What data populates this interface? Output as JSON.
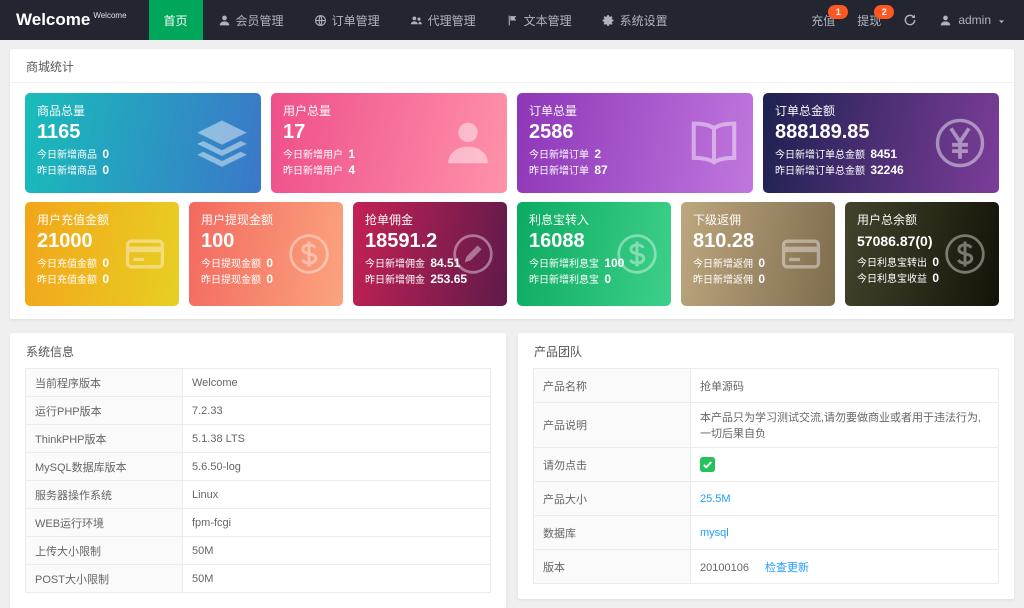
{
  "navbar": {
    "brand": "Welcome",
    "brand_sup": "Welcome",
    "menu": [
      {
        "label": "首页",
        "icon": "",
        "active": true
      },
      {
        "label": "会员管理",
        "icon": "user",
        "active": false
      },
      {
        "label": "订单管理",
        "icon": "globe",
        "active": false
      },
      {
        "label": "代理管理",
        "icon": "users",
        "active": false
      },
      {
        "label": "文本管理",
        "icon": "flag",
        "active": false
      },
      {
        "label": "系统设置",
        "icon": "gear",
        "active": false
      }
    ],
    "actions": [
      {
        "label": "充值",
        "badge": "1"
      },
      {
        "label": "提现",
        "badge": "2"
      }
    ],
    "user": {
      "name": "admin"
    }
  },
  "stats": {
    "title": "商城统计",
    "row1": [
      {
        "title": "商品总量",
        "value": "1165",
        "icon": "layers",
        "grad": [
          "#18bdba",
          "#3b77c9"
        ],
        "lines": [
          {
            "label": "今日新增商品",
            "value": "0"
          },
          {
            "label": "昨日新增商品",
            "value": "0"
          }
        ]
      },
      {
        "title": "用户总量",
        "value": "17",
        "icon": "user",
        "grad": [
          "#ee4f8b",
          "#ff92a9"
        ],
        "lines": [
          {
            "label": "今日新增用户",
            "value": "1"
          },
          {
            "label": "昨日新增用户",
            "value": "4"
          }
        ]
      },
      {
        "title": "订单总量",
        "value": "2586",
        "icon": "book",
        "grad": [
          "#8d36b8",
          "#c077dd"
        ],
        "lines": [
          {
            "label": "今日新增订单",
            "value": "2"
          },
          {
            "label": "昨日新增订单",
            "value": "87"
          }
        ]
      },
      {
        "title": "订单总金额",
        "value": "888189.85",
        "icon": "yen",
        "grad": [
          "#1e2150",
          "#7c3d99"
        ],
        "lines": [
          {
            "label": "今日新增订单总金额",
            "value": "8451"
          },
          {
            "label": "昨日新增订单总金额",
            "value": "32246"
          }
        ]
      }
    ],
    "row2": [
      {
        "title": "用户充值金额",
        "value": "21000",
        "icon": "card",
        "grad": [
          "#f2a51a",
          "#e8cf24"
        ],
        "lines": [
          {
            "label": "今日充值金额",
            "value": "0"
          },
          {
            "label": "昨日充值金额",
            "value": "0"
          }
        ]
      },
      {
        "title": "用户提现金额",
        "value": "100",
        "icon": "dollar",
        "grad": [
          "#f3695f",
          "#fba47e"
        ],
        "lines": [
          {
            "label": "今日提现金额",
            "value": "0"
          },
          {
            "label": "昨日提现金额",
            "value": "0"
          }
        ]
      },
      {
        "title": "抢单佣金",
        "value": "18591.2",
        "icon": "edit",
        "grad": [
          "#c42154",
          "#5f1a4a"
        ],
        "lines": [
          {
            "label": "今日新增佣金",
            "value": "84.51"
          },
          {
            "label": "昨日新增佣金",
            "value": "253.65"
          }
        ]
      },
      {
        "title": "利息宝转入",
        "value": "16088",
        "icon": "dollar",
        "grad": [
          "#0cab61",
          "#3ed08a"
        ],
        "lines": [
          {
            "label": "今日新增利息宝",
            "value": "100"
          },
          {
            "label": "昨日新增利息宝",
            "value": "0"
          }
        ]
      },
      {
        "title": "下级返佣",
        "value": "810.28",
        "icon": "card",
        "grad": [
          "#bda77e",
          "#7e6c4e"
        ],
        "lines": [
          {
            "label": "今日新增返佣",
            "value": "0"
          },
          {
            "label": "昨日新增返佣",
            "value": "0"
          }
        ]
      },
      {
        "title": "用户总余额",
        "value": "57086.87(0)",
        "icon": "dollar",
        "grad": [
          "#43442c",
          "#131308"
        ],
        "lines": [
          {
            "label": "今日利息宝转出",
            "value": "0"
          },
          {
            "label": "今日利息宝收益",
            "value": "0"
          }
        ]
      }
    ]
  },
  "system_info": {
    "title": "系统信息",
    "rows": [
      {
        "label": "当前程序版本",
        "value": "Welcome"
      },
      {
        "label": "运行PHP版本",
        "value": "7.2.33"
      },
      {
        "label": "ThinkPHP版本",
        "value": "5.1.38 LTS"
      },
      {
        "label": "MySQL数据库版本",
        "value": "5.6.50-log"
      },
      {
        "label": "服务器操作系统",
        "value": "Linux"
      },
      {
        "label": "WEB运行环境",
        "value": "fpm-fcgi"
      },
      {
        "label": "上传大小限制",
        "value": "50M"
      },
      {
        "label": "POST大小限制",
        "value": "50M"
      }
    ]
  },
  "product_team": {
    "title": "产品团队",
    "rows": [
      {
        "label": "产品名称",
        "value": "抢单源码",
        "type": "text"
      },
      {
        "label": "产品说明",
        "value": "本产品只为学习测试交流,请勿要做商业或者用于违法行为,一切后果自负",
        "type": "text"
      },
      {
        "label": "请勿点击",
        "value": "",
        "type": "icon"
      },
      {
        "label": "产品大小",
        "value": "25.5M",
        "type": "link"
      },
      {
        "label": "数据库",
        "value": "mysql",
        "type": "link"
      },
      {
        "label": "版本",
        "value": "20100106",
        "type": "version",
        "link_label": "检查更新"
      }
    ]
  },
  "colors": {
    "nav_active": "#00a65a",
    "badge": "#ff5722",
    "link": "#1e9fff",
    "navbar_bg": "#232631"
  }
}
